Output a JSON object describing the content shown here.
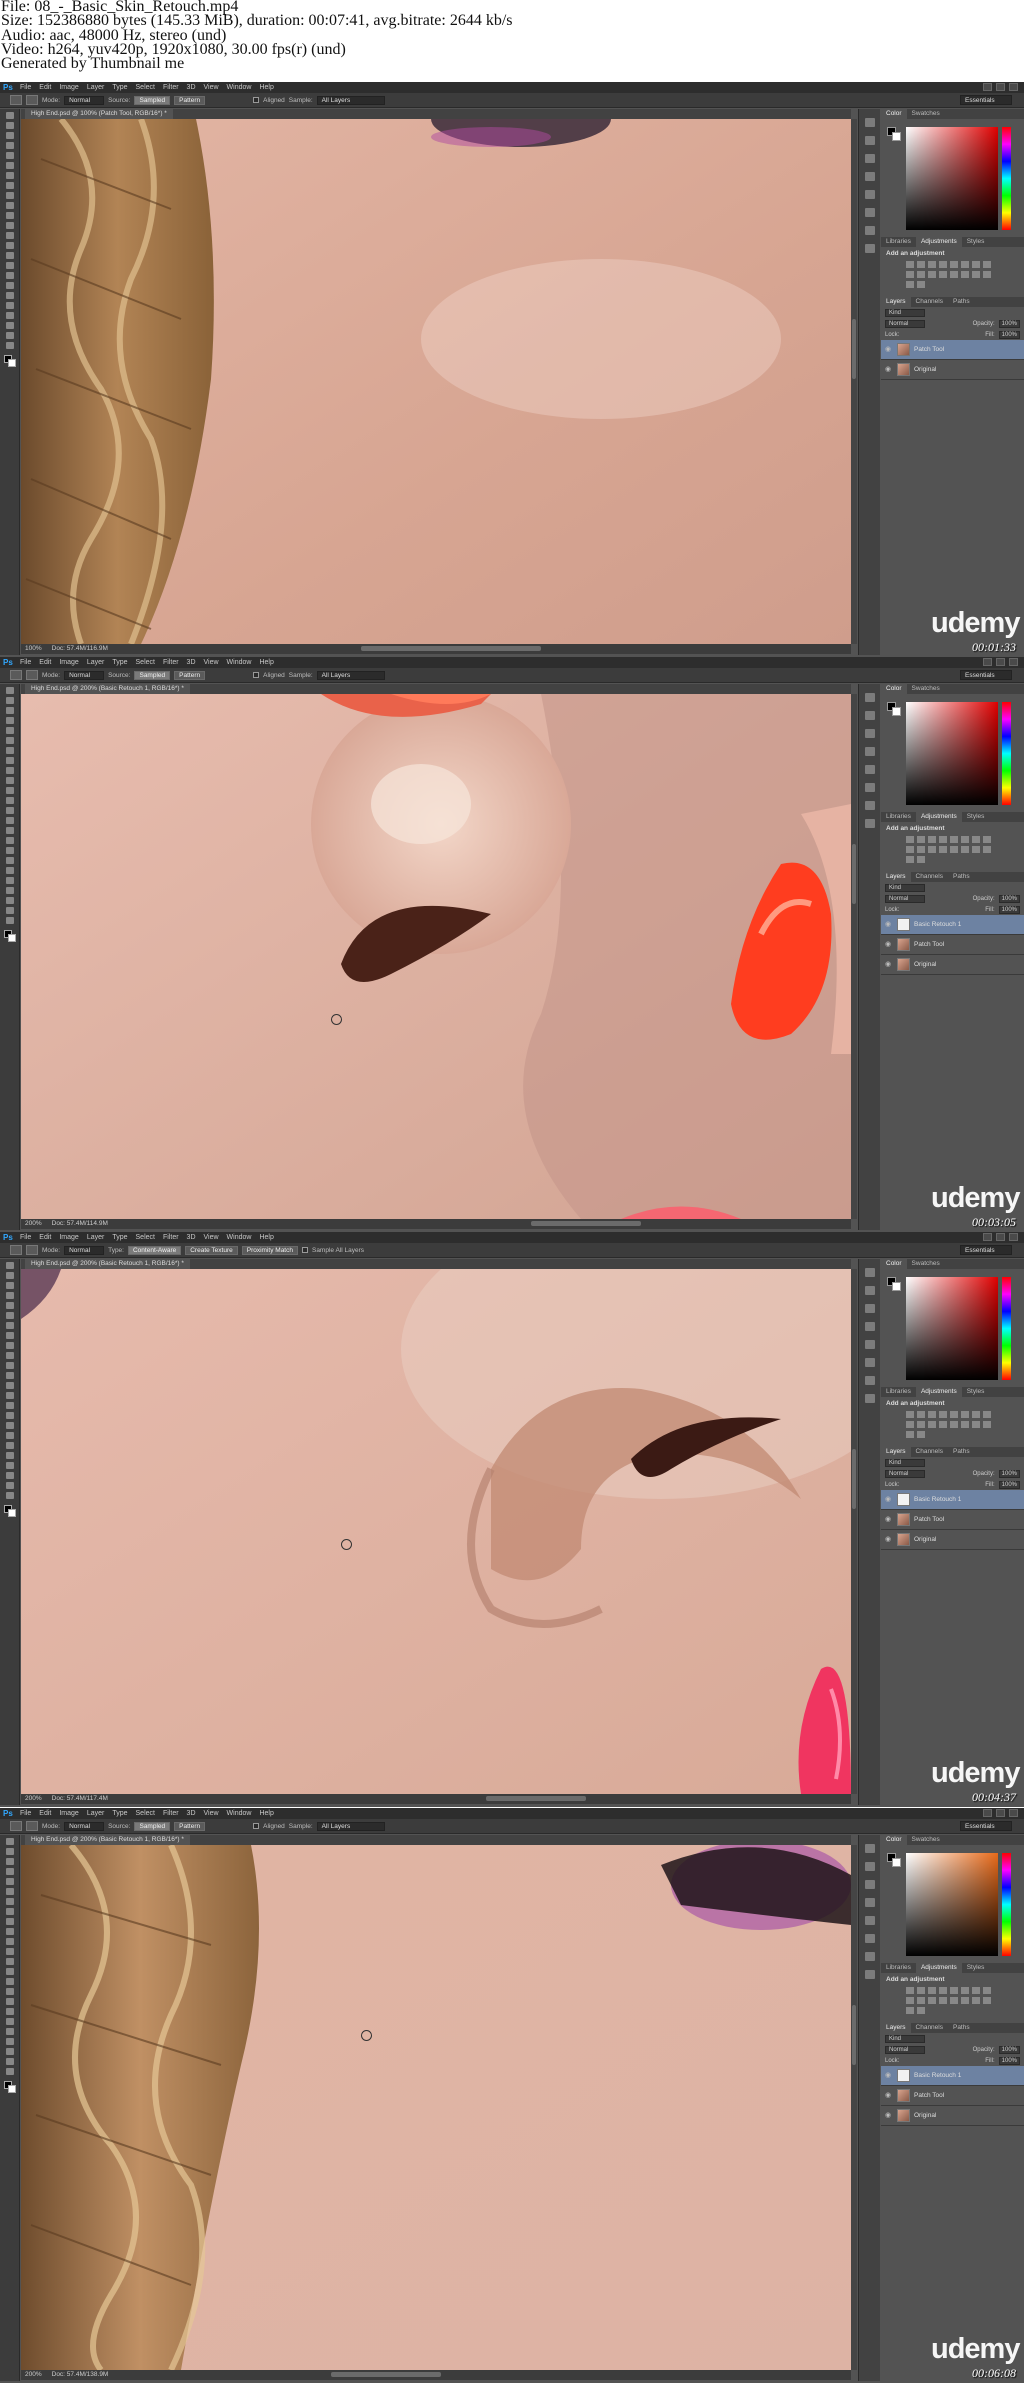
{
  "file_info": {
    "line1": "File: 08_-_Basic_Skin_Retouch.mp4",
    "line2": "Size: 152386880 bytes (145.33 MiB), duration: 00:07:41, avg.bitrate: 2644 kb/s",
    "line3": "Audio: aac, 48000 Hz, stereo (und)",
    "line4": "Video: h264, yuv420p, 1920x1080, 30.00 fps(r) (und)",
    "line5": "Generated by Thumbnail me"
  },
  "menu": [
    "File",
    "Edit",
    "Image",
    "Layer",
    "Type",
    "Select",
    "Filter",
    "3D",
    "View",
    "Window",
    "Help"
  ],
  "app_logo": "Ps",
  "workspace": "Essentials",
  "panels": {
    "color_tabs": [
      "Color",
      "Swatches"
    ],
    "adj_tabs": [
      "Libraries",
      "Adjustments",
      "Styles"
    ],
    "adj_title": "Add an adjustment",
    "layers_tabs": [
      "Layers",
      "Channels",
      "Paths"
    ],
    "kind": "Kind",
    "blend": "Normal",
    "opacity_label": "Opacity:",
    "opacity": "100%",
    "lock_label": "Lock:",
    "fill_label": "Fill:",
    "fill": "100%"
  },
  "watermark": "udemy",
  "frames": [
    {
      "options": {
        "mode_label": "Mode:",
        "mode": "Normal",
        "source_label": "Source:",
        "source": "Sampled",
        "pattern": "Pattern",
        "aligned": "Aligned",
        "sample_label": "Sample:",
        "sample": "All Layers"
      },
      "doc_title": "High End.psd @ 100% (Patch Tool, RGB/16*) *",
      "zoom": "100%",
      "doc": "Doc: 57.4M/116.9M",
      "layers": [
        {
          "name": "Patch Tool",
          "selected": true,
          "white": false
        },
        {
          "name": "Original",
          "selected": false,
          "white": false
        }
      ],
      "timestamp": "00:01:33"
    },
    {
      "options": {
        "mode_label": "Mode:",
        "mode": "Normal",
        "source_label": "Source:",
        "source": "Sampled",
        "pattern": "Pattern",
        "aligned": "Aligned",
        "sample_label": "Sample:",
        "sample": "All Layers"
      },
      "doc_title": "High End.psd @ 200% (Basic Retouch 1, RGB/16*) *",
      "zoom": "200%",
      "doc": "Doc: 57.4M/114.9M",
      "layers": [
        {
          "name": "Basic Retouch 1",
          "selected": true,
          "white": true
        },
        {
          "name": "Patch Tool",
          "selected": false,
          "white": false
        },
        {
          "name": "Original",
          "selected": false,
          "white": false
        }
      ],
      "timestamp": "00:03:05"
    },
    {
      "options": {
        "mode_label": "Mode:",
        "mode": "Normal",
        "type_label": "Type:",
        "type1": "Content-Aware",
        "type2": "Create Texture",
        "type3": "Proximity Match",
        "sample_all": "Sample All Layers"
      },
      "doc_title": "High End.psd @ 200% (Basic Retouch 1, RGB/16*) *",
      "zoom": "200%",
      "doc": "Doc: 57.4M/117.4M",
      "layers": [
        {
          "name": "Basic Retouch 1",
          "selected": true,
          "white": true
        },
        {
          "name": "Patch Tool",
          "selected": false,
          "white": false
        },
        {
          "name": "Original",
          "selected": false,
          "white": false
        }
      ],
      "timestamp": "00:04:37"
    },
    {
      "options": {
        "mode_label": "Mode:",
        "mode": "Normal",
        "source_label": "Source:",
        "source": "Sampled",
        "pattern": "Pattern",
        "aligned": "Aligned",
        "sample_label": "Sample:",
        "sample": "All Layers"
      },
      "doc_title": "High End.psd @ 200% (Basic Retouch 1, RGB/16*) *",
      "zoom": "200%",
      "doc": "Doc: 57.4M/138.9M",
      "layers": [
        {
          "name": "Basic Retouch 1",
          "selected": true,
          "white": true
        },
        {
          "name": "Patch Tool",
          "selected": false,
          "white": false
        },
        {
          "name": "Original",
          "selected": false,
          "white": false
        }
      ],
      "timestamp": "00:06:08"
    }
  ]
}
